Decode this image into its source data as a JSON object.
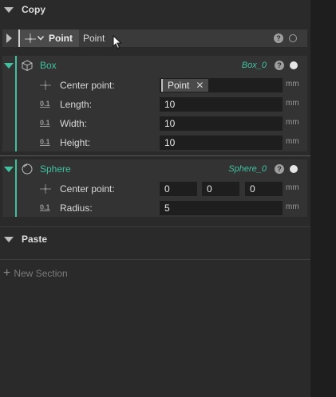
{
  "colors": {
    "accent": "#3fc1a0",
    "panel": "#2a2a2a",
    "field": "#1e1e1e"
  },
  "copy_section": {
    "title": "Copy"
  },
  "copy_row": {
    "button_label": "Point",
    "text": "Point"
  },
  "box": {
    "name": "Box",
    "id": "Box_0",
    "params": {
      "center_label": "Center point:",
      "center_chip": "Point",
      "length_label": "Length:",
      "length_value": "10",
      "width_label": "Width:",
      "width_value": "10",
      "height_label": "Height:",
      "height_value": "10",
      "unit": "mm"
    }
  },
  "sphere": {
    "name": "Sphere",
    "id": "Sphere_0",
    "params": {
      "center_label": "Center point:",
      "cx": "0",
      "cy": "0",
      "cz": "0",
      "radius_label": "Radius:",
      "radius_value": "5",
      "unit": "mm"
    }
  },
  "paste_section": {
    "title": "Paste"
  },
  "new_section": {
    "label": "New Section"
  },
  "icons": [
    "chevron-down-icon",
    "chevron-right-icon",
    "point-icon",
    "box-icon",
    "sphere-icon",
    "number-icon",
    "help-icon",
    "visibility-dot-icon",
    "close-icon",
    "plus-icon",
    "mouse-cursor-icon"
  ]
}
